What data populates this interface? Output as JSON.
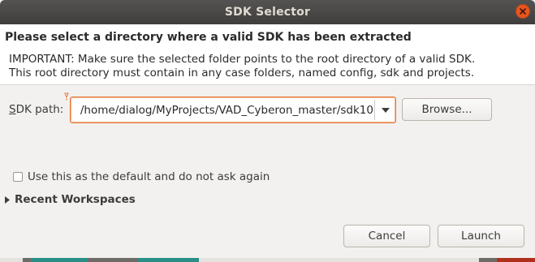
{
  "window": {
    "title": "SDK Selector"
  },
  "header": {
    "title": "Please select a directory where a valid SDK has been extracted",
    "line1": "IMPORTANT: Make sure the selected folder points to the root directory of a valid SDK.",
    "line2": "This root directory must contain in any case folders, named config, sdk and projects."
  },
  "sdk": {
    "label_first": "S",
    "label_rest": "DK path:",
    "path_value": "/home/dialog/MyProjects/VAD_Cyberon_master/sdk10",
    "browse_label": "Browse..."
  },
  "options": {
    "default_checkbox_label": "Use this as the default and do not ask again",
    "default_checked": false
  },
  "recent": {
    "label": "Recent Workspaces",
    "expanded": false
  },
  "footer": {
    "cancel_label": "Cancel",
    "launch_label": "Launch"
  },
  "icons": {
    "close": "close-icon",
    "dropdown": "chevron-down-icon",
    "expander": "triangle-right-icon",
    "marker": "info-marker-icon"
  },
  "colors": {
    "focus_border": "#e9783b",
    "close_button": "#e9541f",
    "titlebar": "#403e3c"
  }
}
